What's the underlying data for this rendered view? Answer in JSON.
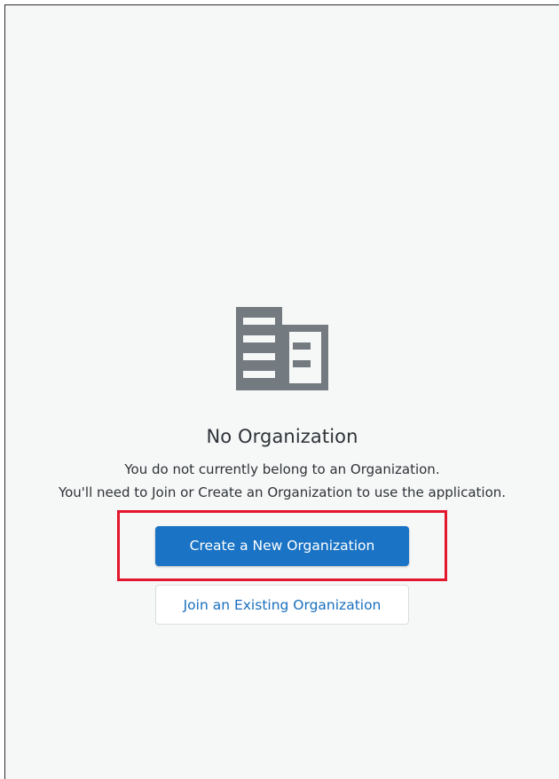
{
  "empty_state": {
    "icon": "building-icon",
    "title": "No Organization",
    "message_line1": "You do not currently belong to an Organization.",
    "message_line2": "You'll need to Join or Create an Organization to use the application."
  },
  "actions": {
    "create_label": "Create a New Organization",
    "join_label": "Join an Existing Organization"
  },
  "colors": {
    "primary": "#1a73c4",
    "highlight": "#e3172d",
    "icon": "#737a80"
  }
}
